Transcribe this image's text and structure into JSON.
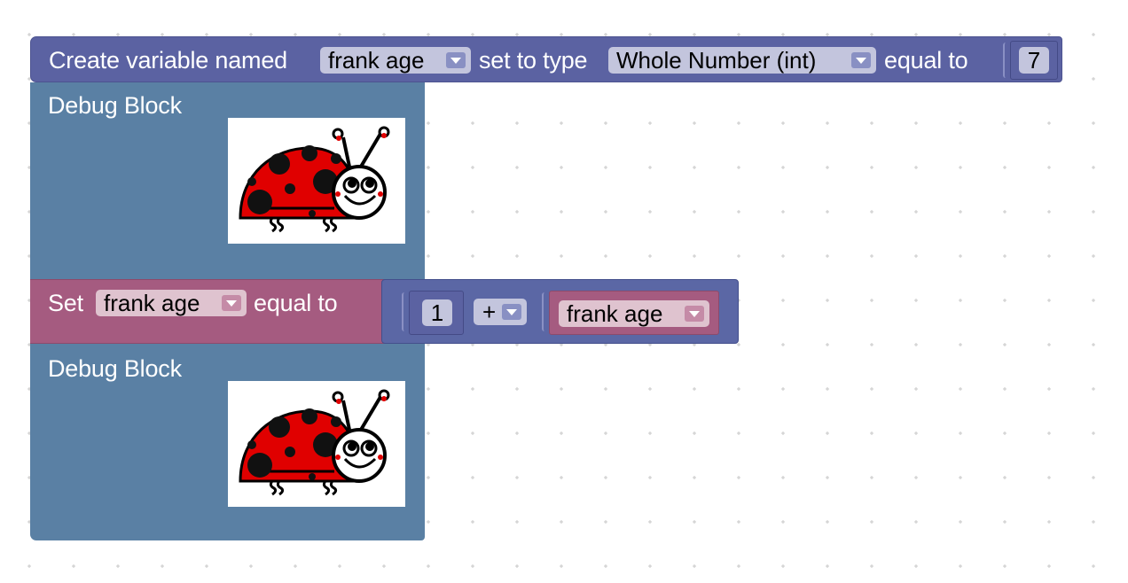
{
  "colors": {
    "variable_block": "#5b62a2",
    "debug_block": "#5a80a4",
    "set_block": "#a55b80",
    "math_block": "#5b67a5",
    "field_light": "#c3c5dd",
    "field_pink": "#dfc3cf",
    "grid_dot": "#c8c8c8"
  },
  "create_block": {
    "label_prefix": "Create variable named",
    "var_name": "frank age",
    "label_type": "set to type",
    "type_value": "Whole Number (int)",
    "label_equal": "equal to",
    "initial_value": "7"
  },
  "debug_blocks": [
    {
      "label": "Debug Block",
      "image": "ladybug-icon"
    },
    {
      "label": "Debug Block",
      "image": "ladybug-icon"
    }
  ],
  "set_block": {
    "label_prefix": "Set",
    "var_name": "frank age",
    "label_equal": "equal to"
  },
  "math_block": {
    "left_value": "1",
    "operator": "+",
    "right_var": "frank age"
  }
}
